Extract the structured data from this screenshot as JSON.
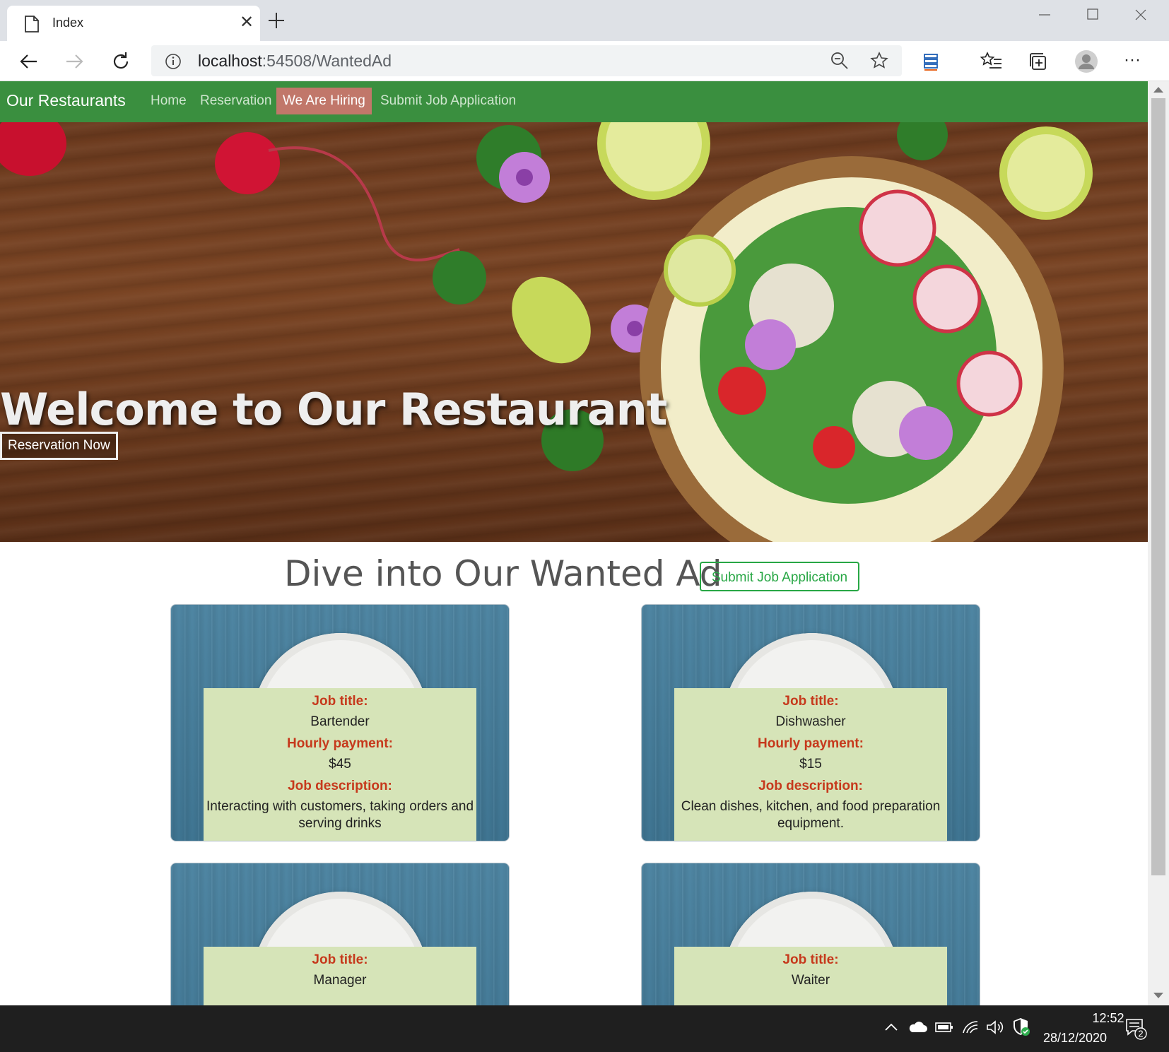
{
  "browser": {
    "tab": {
      "title": "Index",
      "close_glyph": "✕",
      "icon": "page-icon"
    },
    "address": {
      "host": "localhost",
      "path": ":54508/WantedAd"
    },
    "window_controls": [
      "minimize",
      "maximize",
      "close"
    ],
    "more_glyph": "···"
  },
  "nav": {
    "brand": "Our Restaurants",
    "links": [
      {
        "label": "Home",
        "active": false
      },
      {
        "label": "Reservation",
        "active": false
      },
      {
        "label": "We Are Hiring",
        "active": true
      },
      {
        "label": "Submit Job Application",
        "active": false
      }
    ],
    "color": "#3a8f3f",
    "active_color": "#c1776a"
  },
  "hero": {
    "title": "Welcome to Our Restaurant",
    "button": "Reservation Now"
  },
  "wanted": {
    "title": "Dive into Our Wanted Ad",
    "submit_button": "Submit Job Application",
    "labels": {
      "job_title": "Job title:",
      "hourly_payment": "Hourly payment:",
      "job_description": "Job description:"
    },
    "jobs": [
      {
        "title": "Bartender",
        "payment": "$45",
        "description": "Interacting with customers, taking orders and serving drinks"
      },
      {
        "title": "Dishwasher",
        "payment": "$15",
        "description": "Clean dishes, kitchen, and food preparation equipment."
      },
      {
        "title": "Manager",
        "payment": "",
        "description": ""
      },
      {
        "title": "Waiter",
        "payment": "",
        "description": ""
      }
    ],
    "accent_color": "#28a745",
    "label_color": "#c6391c"
  },
  "taskbar": {
    "time": "12:52",
    "date": "28/12/2020",
    "notification_count": "2"
  }
}
